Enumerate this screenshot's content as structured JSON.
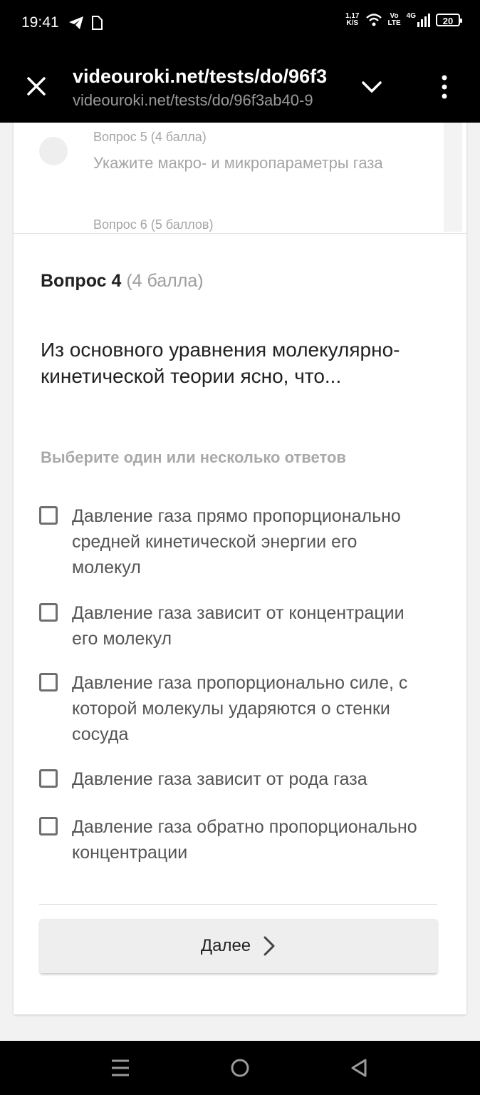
{
  "status_bar": {
    "time": "19:41",
    "speed_value": "1,17",
    "speed_unit": "K/S",
    "volte_top": "Vo",
    "volte_bottom": "LTE",
    "network": "4G",
    "battery": "20",
    "icons": [
      "telegram-icon",
      "file-icon",
      "wifi-icon",
      "signal-icon",
      "battery-icon"
    ]
  },
  "browser": {
    "title": "videouroki.net/tests/do/96f3",
    "url": "videouroki.net/tests/do/96f3ab40-9",
    "icons": [
      "close-icon",
      "chevron-down-icon",
      "more-vert-icon"
    ]
  },
  "question_list": {
    "q5_label": "Вопрос 5 (4 балла)",
    "q5_text": "Укажите макро- и микропараметры газа",
    "q6_label": "Вопрос 6 (5 баллов)"
  },
  "question": {
    "title": "Вопрос 4",
    "points": "(4 балла)",
    "text": "Из основного уравнения молекулярно-кинетической теории ясно, что...",
    "hint": "Выберите один или несколько ответов",
    "options": [
      {
        "text": "Давление газа прямо пропорционально средней кинетической энергии его молекул",
        "checked": false
      },
      {
        "text": "Давление газа зависит от концентрации его молекул",
        "checked": false
      },
      {
        "text": "Давление газа пропорционально силе, с которой молекулы ударяются о стенки сосуда",
        "checked": false
      },
      {
        "text": "Давление газа зависит от рода газа",
        "checked": false
      },
      {
        "text": "Давление газа обратно пропорционально концентрации",
        "checked": false
      }
    ]
  },
  "next_button": {
    "label": "Далее",
    "icon": "chevron-right-icon"
  },
  "nav_bar": {
    "icons": [
      "menu-icon",
      "home-icon",
      "back-icon"
    ]
  },
  "colors": {
    "accent_text": "#212121",
    "muted": "#a5a5a5",
    "background": "#f2f2f2"
  }
}
